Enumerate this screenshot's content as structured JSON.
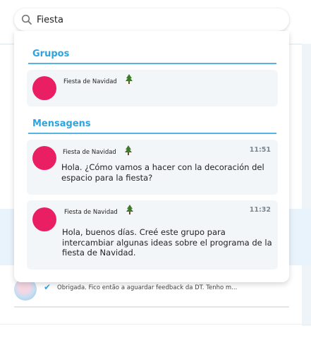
{
  "search": {
    "value": "Fiesta",
    "icon": "search-icon"
  },
  "groups": {
    "title": "Grupos",
    "items": [
      {
        "name": "Fiesta de Navidad",
        "emoji": "🌲"
      }
    ]
  },
  "messages": {
    "title": "Mensagens",
    "items": [
      {
        "chat": "Fiesta de Navidad",
        "time": "11:51",
        "text": "Hola. ¿Cómo vamos a hacer con la decoración del espacio para la fiesta?"
      },
      {
        "chat": "Fiesta de Navidad",
        "time": "11:32",
        "text": "Hola, buenos días. Creé este grupo para intercambiar algunas ideas sobre el programa de la fiesta de Navidad."
      }
    ]
  },
  "background": {
    "chat_preview": "Obrigada. Fico então a aguardar feedback da DT. Tenho m..."
  },
  "colors": {
    "accent": "#2ea3dd",
    "avatar": "#ea1f63",
    "card_bg": "#f3f6f8"
  }
}
